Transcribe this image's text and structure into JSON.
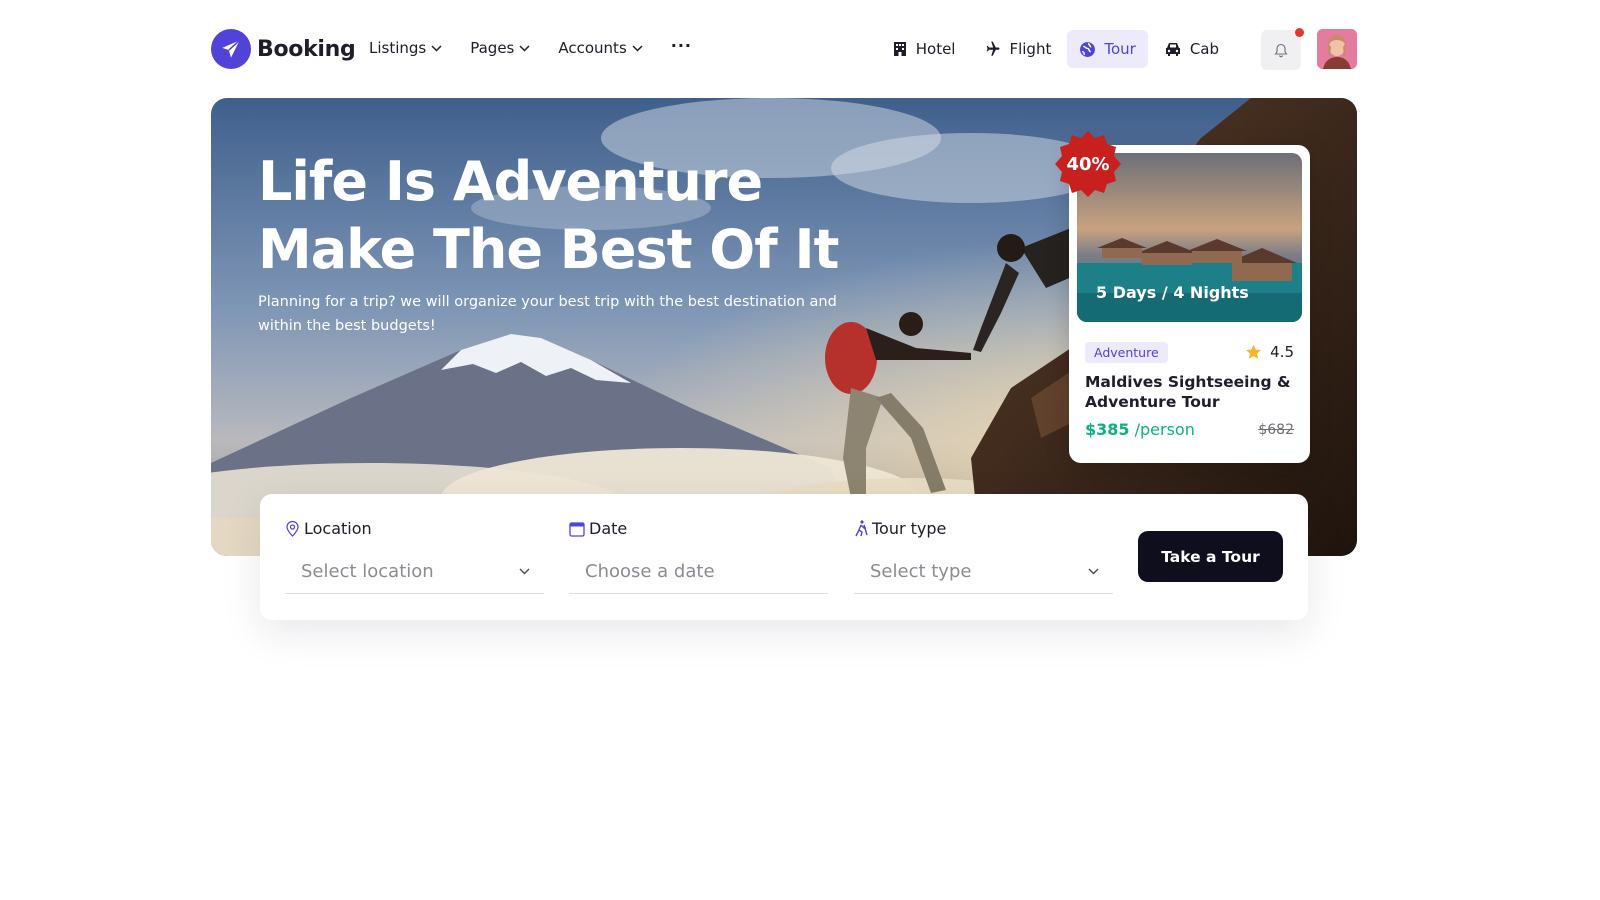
{
  "brand": {
    "name": "Booking",
    "color": "#5143d9"
  },
  "nav": {
    "items": [
      {
        "label": "Listings",
        "icon": "chevron-down-icon"
      },
      {
        "label": "Pages",
        "icon": "chevron-down-icon"
      },
      {
        "label": "Accounts",
        "icon": "chevron-down-icon"
      }
    ],
    "more": "···"
  },
  "categories": [
    {
      "label": "Hotel",
      "icon": "hotel-icon",
      "active": false
    },
    {
      "label": "Flight",
      "icon": "plane-icon",
      "active": false
    },
    {
      "label": "Tour",
      "icon": "globe-icon",
      "active": true
    },
    {
      "label": "Cab",
      "icon": "car-icon",
      "active": false
    }
  ],
  "notifications": {
    "icon": "bell-icon",
    "has_unread": true
  },
  "hero": {
    "title_line1": "Life Is Adventure",
    "title_line2": "Make The Best Of It",
    "subtitle": "Planning for a trip? we will organize your best trip with the best destination and within the best budgets!"
  },
  "tour_card": {
    "discount": "40%",
    "duration": "5 Days / 4 Nights",
    "badge": "Adventure",
    "rating": "4.5",
    "title": "Maldives Sightseeing & Adventure Tour",
    "price": "$385",
    "price_unit": "/person",
    "old_price": "$682"
  },
  "search": {
    "location_label": "Location",
    "location_placeholder": "Select location",
    "date_label": "Date",
    "date_placeholder": "Choose a date",
    "type_label": "Tour type",
    "type_placeholder": "Select type",
    "submit_label": "Take a Tour"
  },
  "colors": {
    "accent": "#5143d9",
    "price_green": "#0fb07f",
    "discount_red": "#c8201f",
    "button_dark": "#0e0e1c"
  }
}
